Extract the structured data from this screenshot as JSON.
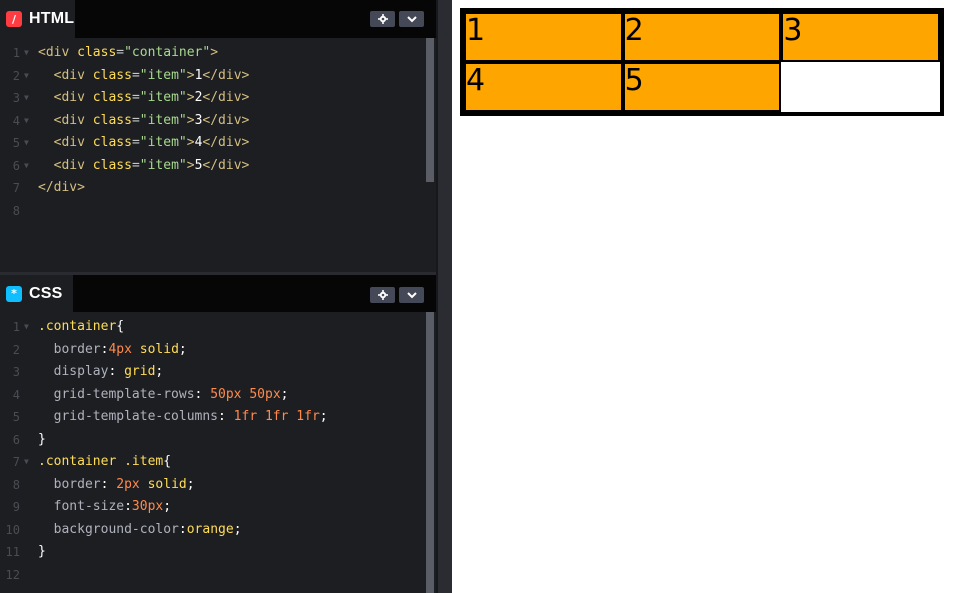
{
  "html_pane": {
    "title": "HTML",
    "icon": "html-icon",
    "icon_color": "#ff3c41",
    "lines": [
      {
        "n": "1",
        "fold": "▼",
        "tokens": [
          [
            "t-tag",
            "<div "
          ],
          [
            "t-attr",
            "class"
          ],
          [
            "t-eq",
            "="
          ],
          [
            "t-str",
            "\"container\""
          ],
          [
            "t-tag",
            ">"
          ]
        ]
      },
      {
        "n": "2",
        "fold": "▼",
        "tokens": [
          [
            "t-tag",
            "  <div "
          ],
          [
            "t-attr",
            "class"
          ],
          [
            "t-eq",
            "="
          ],
          [
            "t-str",
            "\"item\""
          ],
          [
            "t-tag",
            ">"
          ],
          [
            "t-txt",
            "1"
          ],
          [
            "t-tag",
            "</div>"
          ]
        ]
      },
      {
        "n": "3",
        "fold": "▼",
        "tokens": [
          [
            "t-tag",
            "  <div "
          ],
          [
            "t-attr",
            "class"
          ],
          [
            "t-eq",
            "="
          ],
          [
            "t-str",
            "\"item\""
          ],
          [
            "t-tag",
            ">"
          ],
          [
            "t-txt",
            "2"
          ],
          [
            "t-tag",
            "</div>"
          ]
        ]
      },
      {
        "n": "4",
        "fold": "▼",
        "tokens": [
          [
            "t-tag",
            "  <div "
          ],
          [
            "t-attr",
            "class"
          ],
          [
            "t-eq",
            "="
          ],
          [
            "t-str",
            "\"item\""
          ],
          [
            "t-tag",
            ">"
          ],
          [
            "t-txt",
            "3"
          ],
          [
            "t-tag",
            "</div>"
          ]
        ]
      },
      {
        "n": "5",
        "fold": "▼",
        "tokens": [
          [
            "t-tag",
            "  <div "
          ],
          [
            "t-attr",
            "class"
          ],
          [
            "t-eq",
            "="
          ],
          [
            "t-str",
            "\"item\""
          ],
          [
            "t-tag",
            ">"
          ],
          [
            "t-txt",
            "4"
          ],
          [
            "t-tag",
            "</div>"
          ]
        ]
      },
      {
        "n": "6",
        "fold": "▼",
        "tokens": [
          [
            "t-tag",
            "  <div "
          ],
          [
            "t-attr",
            "class"
          ],
          [
            "t-eq",
            "="
          ],
          [
            "t-str",
            "\"item\""
          ],
          [
            "t-tag",
            ">"
          ],
          [
            "t-txt",
            "5"
          ],
          [
            "t-tag",
            "</div>"
          ]
        ]
      },
      {
        "n": "7",
        "fold": "",
        "tokens": [
          [
            "t-tag",
            "</div>"
          ]
        ]
      },
      {
        "n": "8",
        "fold": "",
        "tokens": []
      }
    ]
  },
  "css_pane": {
    "title": "CSS",
    "icon": "css-icon",
    "icon_color": "#0ebeff",
    "lines": [
      {
        "n": "1",
        "fold": "▼",
        "tokens": [
          [
            "t-sel",
            ".container"
          ],
          [
            "t-punc",
            "{"
          ]
        ]
      },
      {
        "n": "2",
        "fold": "",
        "tokens": [
          [
            "t-prop",
            "  border"
          ],
          [
            "t-punc",
            ":"
          ],
          [
            "t-num",
            "4px"
          ],
          [
            "t-kw",
            " solid"
          ],
          [
            "t-punc",
            ";"
          ]
        ]
      },
      {
        "n": "3",
        "fold": "",
        "tokens": [
          [
            "t-prop",
            "  display"
          ],
          [
            "t-punc",
            ": "
          ],
          [
            "t-kw",
            "grid"
          ],
          [
            "t-punc",
            ";"
          ]
        ]
      },
      {
        "n": "4",
        "fold": "",
        "tokens": [
          [
            "t-prop",
            "  grid-template-rows"
          ],
          [
            "t-punc",
            ": "
          ],
          [
            "t-num",
            "50px 50px"
          ],
          [
            "t-punc",
            ";"
          ]
        ]
      },
      {
        "n": "5",
        "fold": "",
        "tokens": [
          [
            "t-prop",
            "  grid-template-columns"
          ],
          [
            "t-punc",
            ": "
          ],
          [
            "t-num",
            "1fr 1fr 1fr"
          ],
          [
            "t-punc",
            ";"
          ]
        ]
      },
      {
        "n": "6",
        "fold": "",
        "tokens": [
          [
            "t-punc",
            "}"
          ]
        ]
      },
      {
        "n": "7",
        "fold": "▼",
        "tokens": [
          [
            "t-sel",
            ".container .item"
          ],
          [
            "t-punc",
            "{"
          ]
        ]
      },
      {
        "n": "8",
        "fold": "",
        "tokens": [
          [
            "t-prop",
            "  border"
          ],
          [
            "t-punc",
            ": "
          ],
          [
            "t-num",
            "2px"
          ],
          [
            "t-kw",
            " solid"
          ],
          [
            "t-punc",
            ";"
          ]
        ]
      },
      {
        "n": "9",
        "fold": "",
        "tokens": [
          [
            "t-prop",
            "  font-size"
          ],
          [
            "t-punc",
            ":"
          ],
          [
            "t-num",
            "30px"
          ],
          [
            "t-punc",
            ";"
          ]
        ]
      },
      {
        "n": "10",
        "fold": "",
        "tokens": [
          [
            "t-prop",
            "  background-color"
          ],
          [
            "t-punc",
            ":"
          ],
          [
            "t-kw",
            "orange"
          ],
          [
            "t-punc",
            ";"
          ]
        ]
      },
      {
        "n": "11",
        "fold": "",
        "tokens": [
          [
            "t-punc",
            "}"
          ]
        ]
      },
      {
        "n": "12",
        "fold": "",
        "tokens": []
      }
    ]
  },
  "preview": {
    "items": [
      "1",
      "2",
      "3",
      "4",
      "5"
    ],
    "item_color": "orange"
  }
}
